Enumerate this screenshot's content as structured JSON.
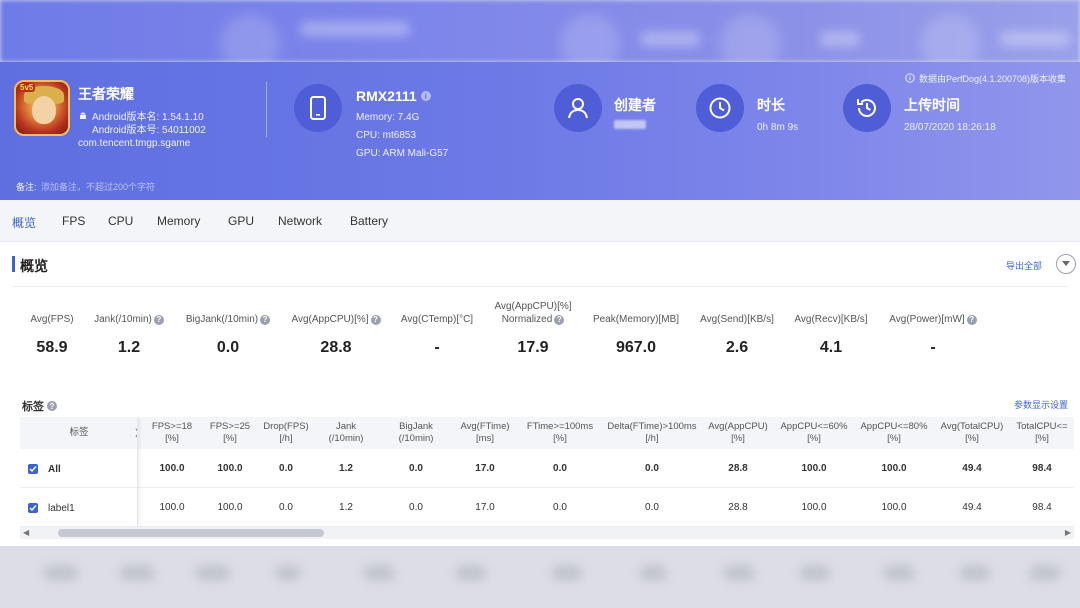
{
  "app": {
    "name": "王者荣耀",
    "version_name": "Android版本名: 1.54.1.10",
    "version_code": "Android版本号: 54011002",
    "package": "com.tencent.tmgp.sgame",
    "icon_badge": "5v5"
  },
  "device": {
    "model": "RMX2111",
    "memory": "Memory: 7.4G",
    "cpu": "CPU: mt6853",
    "gpu": "GPU: ARM Mali-G57"
  },
  "creator": {
    "title": "创建者"
  },
  "duration": {
    "title": "时长",
    "value": "0h 8m 9s"
  },
  "upload": {
    "title": "上传时间",
    "value": "28/07/2020 18:26:18"
  },
  "source_note": "数据由PerfDog(4.1.200708)版本收集",
  "remark": {
    "label": "备注:",
    "placeholder": "添加备注，不超过200个字符"
  },
  "tabs": [
    "概览",
    "FPS",
    "CPU",
    "Memory",
    "GPU",
    "Network",
    "Battery"
  ],
  "section": {
    "title": "概览",
    "export": "导出全部"
  },
  "kpis": [
    {
      "label": "Avg(FPS)",
      "value": "58.9"
    },
    {
      "label": "Jank(/10min)",
      "value": "1.2"
    },
    {
      "label": "BigJank(/10min)",
      "value": "0.0"
    },
    {
      "label": "Avg(AppCPU)[%]",
      "value": "28.8"
    },
    {
      "label": "Avg(CTemp)[°C]",
      "value": "-"
    },
    {
      "label": "Avg(AppCPU)[%]",
      "label2": "Normalized",
      "value": "17.9"
    },
    {
      "label": "Peak(Memory)[MB]",
      "value": "967.0"
    },
    {
      "label": "Avg(Send)[KB/s]",
      "value": "2.6"
    },
    {
      "label": "Avg(Recv)[KB/s]",
      "value": "4.1"
    },
    {
      "label": "Avg(Power)[mW]",
      "value": "-"
    }
  ],
  "labels_section": {
    "title": "标签",
    "settings": "参数显示设置"
  },
  "table": {
    "label_header": "标签",
    "headers": [
      [
        ")",
        ""
      ],
      [
        "FPS>=18",
        "[%]"
      ],
      [
        "FPS>=25",
        "[%]"
      ],
      [
        "Drop(FPS)",
        "[/h]"
      ],
      [
        "Jank",
        "(/10min)"
      ],
      [
        "BigJank",
        "(/10min)"
      ],
      [
        "Avg(FTime)",
        "[ms]"
      ],
      [
        "FTime>=100ms",
        "[%]"
      ],
      [
        "Delta(FTime)>100ms",
        "[/h]"
      ],
      [
        "Avg(AppCPU)",
        "[%]"
      ],
      [
        "AppCPU<=60%",
        "[%]"
      ],
      [
        "AppCPU<=80%",
        "[%]"
      ],
      [
        "Avg(TotalCPU)",
        "[%]"
      ],
      [
        "TotalCPU<=",
        "[%]"
      ]
    ],
    "rows": [
      {
        "label": "All",
        "checked": true,
        "values": [
          "",
          "100.0",
          "100.0",
          "0.0",
          "1.2",
          "0.0",
          "17.0",
          "0.0",
          "0.0",
          "28.8",
          "100.0",
          "100.0",
          "49.4",
          "98.4"
        ]
      },
      {
        "label": "label1",
        "checked": true,
        "values": [
          "",
          "100.0",
          "100.0",
          "0.0",
          "1.2",
          "0.0",
          "17.0",
          "0.0",
          "0.0",
          "28.8",
          "100.0",
          "100.0",
          "49.4",
          "98.4"
        ]
      }
    ]
  },
  "colors": {
    "accent": "#3b63d6",
    "header_start": "#5f6fe0",
    "header_end": "#9196ec"
  }
}
